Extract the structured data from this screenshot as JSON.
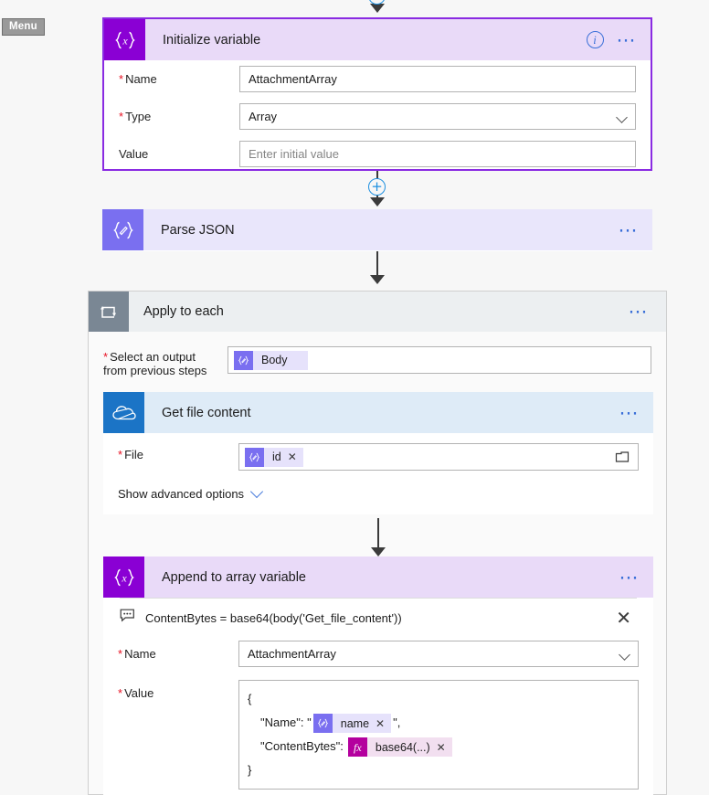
{
  "menu": {
    "label": "Menu"
  },
  "colors": {
    "accent_purple": "#8a00d4",
    "selected_border": "#8a2be2",
    "parse_json_icon": "#7a6ff0",
    "foreach_icon": "#7a8794",
    "onedrive_blue": "#1b74c6",
    "link_blue": "#3a6fd8",
    "required_red": "#e81123",
    "fx_magenta": "#b4009e",
    "canvas_bg": "#f7f7f7"
  },
  "initialize_variable": {
    "title": "Initialize variable",
    "icon": "variable-braces-icon",
    "info_icon": "info-icon",
    "menu_icon": "ellipsis-icon",
    "fields": [
      {
        "label": "Name",
        "required": true,
        "value": "AttachmentArray",
        "placeholder": "",
        "kind": "text"
      },
      {
        "label": "Type",
        "required": true,
        "value": "Array",
        "placeholder": "",
        "kind": "select"
      },
      {
        "label": "Value",
        "required": false,
        "value": "",
        "placeholder": "Enter initial value",
        "kind": "text"
      }
    ]
  },
  "add_step_button": {
    "label": "+"
  },
  "parse_json": {
    "title": "Parse JSON",
    "icon": "json-braces-pencil-icon",
    "menu_icon": "ellipsis-icon"
  },
  "apply_to_each": {
    "title": "Apply to each",
    "icon": "loop-icon",
    "menu_icon": "ellipsis-icon",
    "output_label_line1": "Select an output",
    "output_label_line2": "from previous steps",
    "output_required": true,
    "output_token": {
      "icon": "json-braces-pencil-icon",
      "label": "Body"
    }
  },
  "get_file_content": {
    "title": "Get file content",
    "icon": "onedrive-cloud-icon",
    "menu_icon": "ellipsis-icon",
    "file_label": "File",
    "file_required": true,
    "file_token": {
      "icon": "json-braces-pencil-icon",
      "label": "id",
      "remove": "✕"
    },
    "folder_picker_icon": "folder-icon",
    "show_advanced_label": "Show advanced options",
    "show_advanced_chevron": "chevron-down-icon"
  },
  "append_to_array": {
    "title": "Append to array variable",
    "icon": "variable-braces-icon",
    "menu_icon": "ellipsis-icon",
    "comment": {
      "icon": "comment-icon",
      "text": "ContentBytes = base64(body('Get_file_content'))",
      "close_icon": "close-icon"
    },
    "name_label": "Name",
    "name_required": true,
    "name_value": "AttachmentArray",
    "value_label": "Value",
    "value_required": true,
    "value_lines": {
      "open_brace": "{",
      "name_key": "\"Name\": \"",
      "name_token": {
        "icon": "json-braces-pencil-icon",
        "label": "name",
        "remove": "✕"
      },
      "name_tail": "\",",
      "contentbytes_key": "\"ContentBytes\":",
      "contentbytes_token": {
        "icon": "fx-icon",
        "label": "base64(...)",
        "remove": "✕"
      },
      "close_brace": "}"
    }
  }
}
